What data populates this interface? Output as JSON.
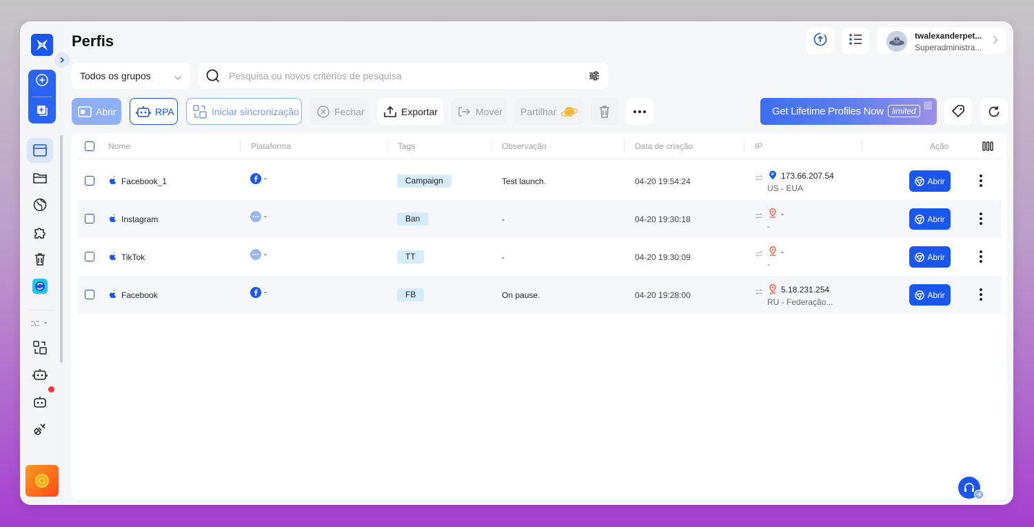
{
  "header": {
    "title": "Perfis"
  },
  "user": {
    "name": "twalexanderpet...",
    "role": "Superadministra..."
  },
  "filters": {
    "group_label": "Todos os grupos",
    "search_placeholder": "Pesquisa ou novos critérios de pesquisa"
  },
  "toolbar": {
    "open": "Abrir",
    "rpa": "RPA",
    "sync": "Iniciar sincronização",
    "close": "Fechar",
    "export": "Exportar",
    "move": "Mover",
    "share": "Partilhar"
  },
  "banner": {
    "text": "Get Lifetime Profiles Now",
    "badge": "limited"
  },
  "table": {
    "headers": {
      "name": "Nome",
      "platform": "Plataforma",
      "tags": "Tags",
      "note": "Observação",
      "created": "Data de criação",
      "ip": "IP",
      "action": "Ação"
    },
    "rows": [
      {
        "name": "Facebook_1",
        "platform_icon": "facebook-icon",
        "platform_text": "-",
        "tag": "Campaign",
        "note": "Test launch.",
        "created": "04-20 19:54:24",
        "ip_icon": "ip-badge-icon",
        "ip": "173.66.207.54",
        "location": "US - EUA",
        "open": "Abrir"
      },
      {
        "name": "Instagram",
        "platform_icon": "more-platform-icon",
        "platform_text": "-",
        "tag": "Ban",
        "note": "-",
        "created": "04-20 19:30:18",
        "ip_icon": "location-pin-icon",
        "ip": "-",
        "location": "-",
        "open": "Abrir"
      },
      {
        "name": "TikTok",
        "platform_icon": "more-platform-icon",
        "platform_text": "-",
        "tag": "TT",
        "note": "-",
        "created": "04-20 19:30:09",
        "ip_icon": "location-pin-icon",
        "ip": "-",
        "location": "-",
        "open": "Abrir"
      },
      {
        "name": "Facebook",
        "platform_icon": "facebook-icon",
        "platform_text": "-",
        "tag": "FB",
        "note": "On pause.",
        "created": "04-20 19:28:00",
        "ip_icon": "location-pin-icon",
        "ip": "5.18.231.254",
        "location": "RU - Federação...",
        "open": "Abrir"
      }
    ]
  },
  "colors": {
    "accent": "#1a56f0",
    "accent_light": "#8fb0f7",
    "tag_bg": "#d6ebfb",
    "alert": "#f5333f",
    "pin": "#f0604d"
  }
}
